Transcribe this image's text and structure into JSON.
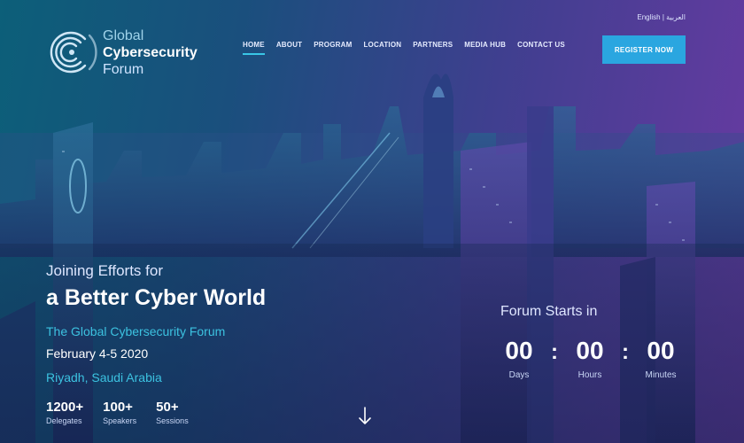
{
  "header": {
    "language_switch": "English | العربية",
    "logo": {
      "line1": "Global",
      "line2": "Cybersecurity",
      "line3": "Forum"
    },
    "nav": [
      {
        "label": "HOME",
        "active": true
      },
      {
        "label": "ABOUT"
      },
      {
        "label": "PROGRAM"
      },
      {
        "label": "LOCATION"
      },
      {
        "label": "PARTNERS"
      },
      {
        "label": "MEDIA HUB"
      },
      {
        "label": "CONTACT US"
      }
    ],
    "register_label": "REGISTER NOW"
  },
  "hero": {
    "tagline_line1": "Joining Efforts for",
    "tagline_line2": "a Better Cyber World",
    "forum_name": "The Global Cybersecurity Forum",
    "date": "February 4-5 2020",
    "location": "Riyadh, Saudi Arabia",
    "stats": [
      {
        "value": "1200+",
        "label": "Delegates"
      },
      {
        "value": "100+",
        "label": "Speakers"
      },
      {
        "value": "50+",
        "label": "Sessions"
      }
    ]
  },
  "countdown": {
    "title": "Forum Starts in",
    "units": [
      {
        "value": "00",
        "label": "Days"
      },
      {
        "value": "00",
        "label": "Hours"
      },
      {
        "value": "00",
        "label": "Minutes"
      }
    ],
    "separator": ":"
  },
  "colors": {
    "accent": "#2aa6e0",
    "highlight": "#3cc2e0"
  },
  "icons": {
    "scroll": "arrow-down-icon",
    "logo": "logo-mark-icon"
  }
}
